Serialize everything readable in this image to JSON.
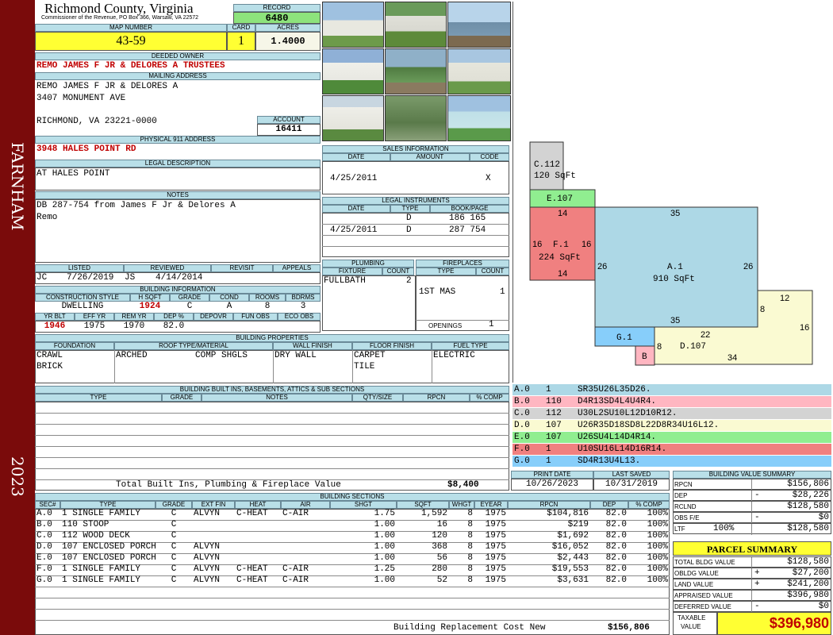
{
  "side": {
    "top": "FARNHAM",
    "bottom": "2023"
  },
  "header": {
    "county": "Richmond County, Virginia",
    "commissioner": "Commissioner of the Revenue, PO Box 366, Warsaw, VA 22572",
    "record_label": "RECORD",
    "record": "6480",
    "map_label": "MAP NUMBER",
    "map": "43-59",
    "card_label": "CARD",
    "card": "1",
    "acres_label": "ACRES",
    "acres": "1.4000"
  },
  "owner": {
    "label": "DEEDED OWNER",
    "name": "REMO JAMES F JR & DELORES A TRUSTEES",
    "mail_label": "MAILING ADDRESS",
    "mail1": "REMO JAMES F JR & DELORES A",
    "mail2": "3407 MONUMENT AVE",
    "mail3": "RICHMOND, VA 23221-0000",
    "account_label": "ACCOUNT",
    "account": "16411",
    "phys_label": "PHYSICAL 911 ADDRESS",
    "phys": "3948 HALES POINT RD"
  },
  "legal": {
    "label": "LEGAL DESCRIPTION",
    "text": "AT HALES POINT",
    "notes_label": "NOTES",
    "notes1": "DB 287-754 from James F Jr & Delores A",
    "notes2": "Remo"
  },
  "listed": {
    "listed_label": "LISTED",
    "reviewed_label": "REVIEWED",
    "revisit_label": "REVISIT",
    "appeals_label": "APPEALS",
    "l_init": "JC",
    "l_date": "7/26/2019",
    "r_init": "JS",
    "r_date": "4/14/2014"
  },
  "bldg": {
    "label": "BUILDING INFORMATION",
    "h": [
      "CONSTRUCTION STYLE",
      "H SQFT",
      "GRADE",
      "COND",
      "ROOMS",
      "BDRMS"
    ],
    "v": [
      "DWELLING",
      "1924",
      "C",
      "A",
      "8",
      "3"
    ],
    "h2": [
      "YR BLT",
      "EFF YR",
      "REM YR",
      "DEP %",
      "DEPOVR",
      "FUN OBS",
      "ECO OBS"
    ],
    "v2": [
      "1946",
      "1975",
      "1970",
      "82.0",
      "",
      "",
      ""
    ]
  },
  "sales": {
    "label": "SALES INFORMATION",
    "h": [
      "DATE",
      "AMOUNT",
      "CODE"
    ],
    "date": "4/25/2011",
    "code": "X"
  },
  "legal_inst": {
    "label": "LEGAL INSTRUMENTS",
    "h": [
      "DATE",
      "TYPE",
      "BOOK/PAGE"
    ],
    "rows": [
      {
        "date": "",
        "type": "D",
        "book": "186 165"
      },
      {
        "date": "4/25/2011",
        "type": "D",
        "book": "287 754"
      }
    ]
  },
  "plumb": {
    "label": "PLUMBING",
    "h": [
      "FIXTURE",
      "COUNT"
    ],
    "fix": "FULLBATH",
    "count": "2"
  },
  "fire": {
    "label": "FIREPLACES",
    "h": [
      "TYPE",
      "COUNT"
    ],
    "type": "1ST MAS",
    "count": "1",
    "open_label": "OPENINGS",
    "open": "1"
  },
  "props": {
    "label": "BUILDING PROPERTIES",
    "h": [
      "FOUNDATION",
      "ROOF TYPE/MATERIAL",
      "WALL FINISH",
      "FLOOR FINISH",
      "FUEL TYPE"
    ],
    "found1": "CRAWL",
    "found2": "BRICK",
    "roof1": "ARCHED",
    "roof2": "COMP SHGLS",
    "wall": "DRY WALL",
    "floor1": "CARPET",
    "floor2": "TILE",
    "fuel": "ELECTRIC"
  },
  "builtins": {
    "label": "BUILDING BUILT INS, BASEMENTS, ATTICS & SUB SECTIONS",
    "h": [
      "TYPE",
      "GRADE",
      "NOTES",
      "QTY/SIZE",
      "RPCN",
      "% COMP"
    ],
    "total_label": "Total Built Ins, Plumbing & Fireplace Value",
    "total": "$8,400"
  },
  "print": {
    "pd_label": "PRINT DATE",
    "pd": "10/26/2023",
    "ls_label": "LAST SAVED",
    "ls": "10/31/2019"
  },
  "sections": {
    "label": "BUILDING SECTIONS",
    "h": [
      "SEC#",
      "TYPE",
      "GRADE",
      "EXT FIN",
      "HEAT",
      "AIR",
      "SHGT",
      "SQFT",
      "WHGT",
      "EYEAR",
      "RPCN",
      "DEP",
      "% COMP"
    ],
    "rows": [
      [
        "A.0",
        "1 SINGLE FAMILY",
        "C",
        "ALVYN",
        "C-HEAT",
        "C-AIR",
        "1.75",
        "1,592",
        "8",
        "1975",
        "$104,816",
        "82.0",
        "100%"
      ],
      [
        "B.0",
        "110 STOOP",
        "C",
        "",
        "",
        "",
        "1.00",
        "16",
        "8",
        "1975",
        "$219",
        "82.0",
        "100%"
      ],
      [
        "C.0",
        "112 WOOD DECK",
        "C",
        "",
        "",
        "",
        "1.00",
        "120",
        "8",
        "1975",
        "$1,692",
        "82.0",
        "100%"
      ],
      [
        "D.0",
        "107 ENCLOSED PORCH",
        "C",
        "ALVYN",
        "",
        "",
        "1.00",
        "368",
        "8",
        "1975",
        "$16,052",
        "82.0",
        "100%"
      ],
      [
        "E.0",
        "107 ENCLOSED PORCH",
        "C",
        "ALVYN",
        "",
        "",
        "1.00",
        "56",
        "8",
        "1975",
        "$2,443",
        "82.0",
        "100%"
      ],
      [
        "F.0",
        "1 SINGLE FAMILY",
        "C",
        "ALVYN",
        "C-HEAT",
        "C-AIR",
        "1.25",
        "280",
        "8",
        "1975",
        "$19,553",
        "82.0",
        "100%"
      ],
      [
        "G.0",
        "1 SINGLE FAMILY",
        "C",
        "ALVYN",
        "C-HEAT",
        "C-AIR",
        "1.00",
        "52",
        "8",
        "1975",
        "$3,631",
        "82.0",
        "100%"
      ]
    ],
    "repl_label": "Building Replacement Cost New",
    "repl": "$156,806"
  },
  "legend": [
    {
      "sec": "A.0",
      "n": "1",
      "code": "SR35U26L35D26.",
      "color": "#add8e6"
    },
    {
      "sec": "B.0",
      "n": "110",
      "code": "D4R13SD4L4U4R4.",
      "color": "#ffb6c1"
    },
    {
      "sec": "C.0",
      "n": "112",
      "code": "U30L2SU10L12D10R12.",
      "color": "#d3d3d3"
    },
    {
      "sec": "D.0",
      "n": "107",
      "code": "U26R35D18SD8L22D8R34U16L12.",
      "color": "#fafad2"
    },
    {
      "sec": "E.0",
      "n": "107",
      "code": "U26SU4L14D4R14.",
      "color": "#90ee90"
    },
    {
      "sec": "F.0",
      "n": "1",
      "code": "U10SU16L14D16R14.",
      "color": "#f08080"
    },
    {
      "sec": "G.0",
      "n": "1",
      "code": "SD4R13U4L13.",
      "color": "#87cefa"
    }
  ],
  "sketch": {
    "c_label": "C.112",
    "c_area": "120 SqFt",
    "e_label": "E.107",
    "f_label": "F.1",
    "f_area": "224 SqFt",
    "a_label": "A.1",
    "a_area": "910 SqFt",
    "g_label": "G.1",
    "b_label": "B",
    "d_label": "D.107",
    "dims": {
      "f_top": "14",
      "f_left": "16",
      "f_right": "16",
      "f_bot": "14",
      "a_top": "35",
      "a_left": "26",
      "a_right": "26",
      "a_bot": "35",
      "d8": "8",
      "d12": "12",
      "d16": "16",
      "d22": "22",
      "d34": "34",
      "b8": "8"
    }
  },
  "bv": {
    "label": "BUILDING VALUE SUMMARY",
    "rows": [
      {
        "k": "RPCN",
        "s": "",
        "v": "$156,806"
      },
      {
        "k": "DEP",
        "s": "-",
        "v": "$28,226"
      },
      {
        "k": "RCLND",
        "s": "",
        "v": "$128,580"
      },
      {
        "k": "OBS F/E",
        "s": "-",
        "v": "$0"
      },
      {
        "k": "LTF",
        "s": "100%",
        "v": "$128,580"
      }
    ]
  },
  "ps": {
    "label": "PARCEL SUMMARY",
    "rows": [
      {
        "k": "TOTAL BLDG VALUE",
        "s": "",
        "v": "$128,580"
      },
      {
        "k": "OBLDG VALUE",
        "s": "+",
        "v": "$27,200"
      },
      {
        "k": "LAND VALUE",
        "s": "+",
        "v": "$241,200"
      },
      {
        "k": "APPRAISED VALUE",
        "s": "",
        "v": "$396,980"
      },
      {
        "k": "DEFERRED VALUE",
        "s": "-",
        "v": "$0"
      }
    ],
    "tax_label1": "TAXABLE",
    "tax_label2": "VALUE",
    "tax": "$396,980"
  }
}
